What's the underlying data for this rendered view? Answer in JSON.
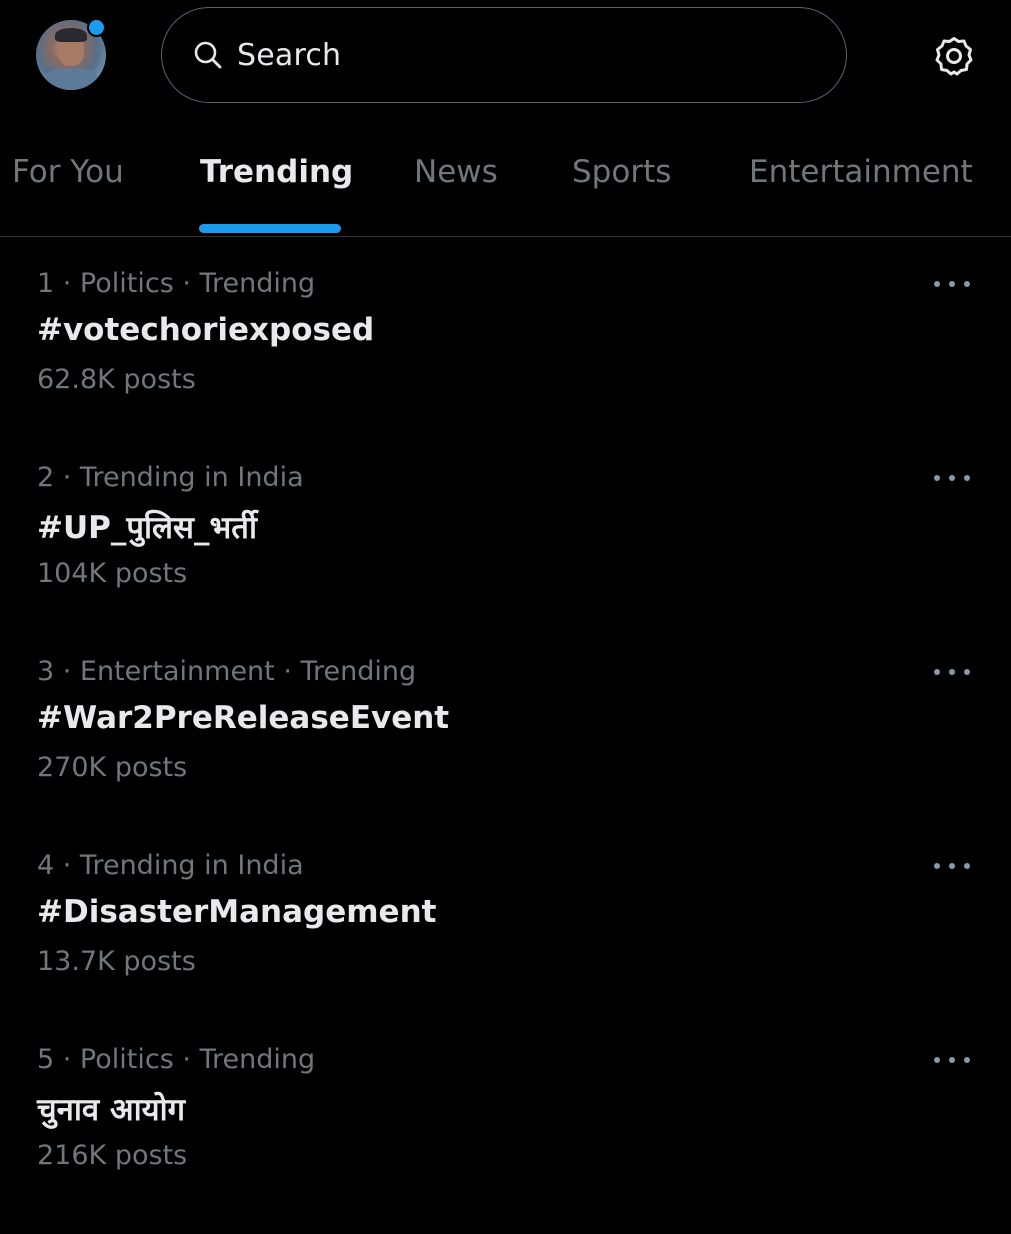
{
  "header": {
    "search_placeholder": "Search",
    "accent_color": "#1d9bf0",
    "icons": {
      "avatar": "user-avatar",
      "search": "search-icon",
      "settings": "gear-icon"
    }
  },
  "tabs": [
    {
      "label": "For You",
      "active": false
    },
    {
      "label": "Trending",
      "active": true
    },
    {
      "label": "News",
      "active": false
    },
    {
      "label": "Sports",
      "active": false
    },
    {
      "label": "Entertainment",
      "active": false
    }
  ],
  "trends": [
    {
      "meta": "1 · Politics · Trending",
      "title": "#votechoriexposed",
      "count": "62.8K posts"
    },
    {
      "meta": "2 · Trending in India",
      "title": "#UP_पुलिस_भर्ती",
      "count": "104K posts"
    },
    {
      "meta": "3 · Entertainment · Trending",
      "title": "#War2PreReleaseEvent",
      "count": "270K posts"
    },
    {
      "meta": "4 · Trending in India",
      "title": "#DisasterManagement",
      "count": "13.7K posts"
    },
    {
      "meta": "5 · Politics · Trending",
      "title": "चुनाव आयोग",
      "count": "216K posts"
    }
  ]
}
